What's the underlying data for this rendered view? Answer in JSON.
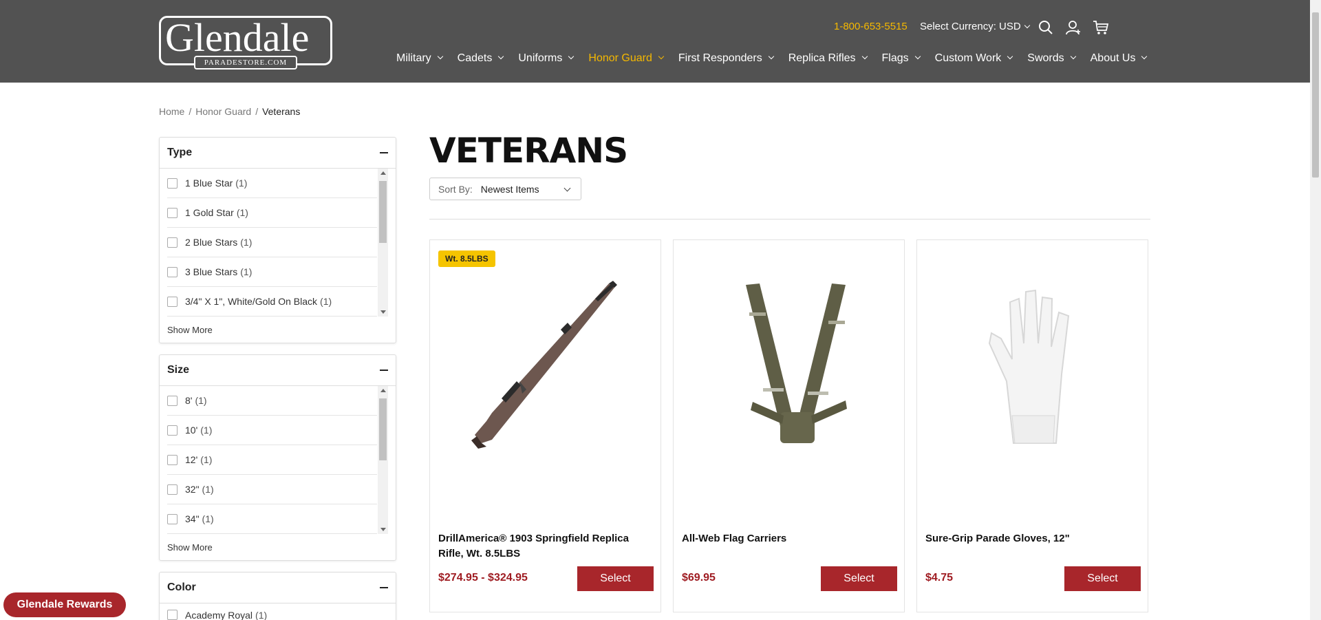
{
  "header": {
    "logo_text": "Glendale",
    "logo_sub": "PARADESTORE.COM",
    "phone": "1-800-653-5515",
    "currency_label": "Select Currency: USD",
    "nav": [
      {
        "label": "Military"
      },
      {
        "label": "Cadets"
      },
      {
        "label": "Uniforms"
      },
      {
        "label": "Honor Guard"
      },
      {
        "label": "First Responders"
      },
      {
        "label": "Replica Rifles"
      },
      {
        "label": "Flags"
      },
      {
        "label": "Custom Work"
      },
      {
        "label": "Swords"
      },
      {
        "label": "About Us"
      }
    ],
    "active_nav": "Honor Guard",
    "active_color": "#f5b800",
    "background_color": "#525252"
  },
  "breadcrumb": {
    "items": [
      "Home",
      "Honor Guard",
      "Veterans"
    ],
    "separator": "/"
  },
  "facets": {
    "show_more_label": "Show More",
    "type": {
      "title": "Type",
      "items": [
        {
          "label": "1 Blue Star",
          "count": "(1)"
        },
        {
          "label": "1 Gold Star",
          "count": "(1)"
        },
        {
          "label": "2 Blue Stars",
          "count": "(1)"
        },
        {
          "label": "3 Blue Stars",
          "count": "(1)"
        },
        {
          "label": "3/4\" X 1\", White/Gold On Black",
          "count": "(1)"
        }
      ]
    },
    "size": {
      "title": "Size",
      "items": [
        {
          "label": "8'",
          "count": "(1)"
        },
        {
          "label": "10'",
          "count": "(1)"
        },
        {
          "label": "12'",
          "count": "(1)"
        },
        {
          "label": "32\"",
          "count": "(1)"
        },
        {
          "label": "34\"",
          "count": "(1)"
        }
      ]
    },
    "color": {
      "title": "Color",
      "items": [
        {
          "label": "Academy Royal",
          "count": "(1)"
        }
      ]
    }
  },
  "main": {
    "title": "VETERANS",
    "sort_label": "Sort By:",
    "sort_value": "Newest Items"
  },
  "products": [
    {
      "badge": "Wt. 8.5LBS",
      "name": "DrillAmerica® 1903 Springfield Replica Rifle, Wt. 8.5LBS",
      "price": "$274.95 - $324.95",
      "button": "Select",
      "image_icon": "rifle-image"
    },
    {
      "badge": "",
      "name": "All-Web Flag Carriers",
      "price": "$69.95",
      "button": "Select",
      "image_icon": "flag-carrier-image"
    },
    {
      "badge": "",
      "name": "Sure-Grip Parade Gloves, 12\"",
      "price": "$4.75",
      "button": "Select",
      "image_icon": "gloves-image"
    }
  ],
  "brand_color": "#a8262b",
  "price_color": "#9f1c22",
  "badge_color": "#f5c400",
  "rewards_label": "Glendale Rewards"
}
